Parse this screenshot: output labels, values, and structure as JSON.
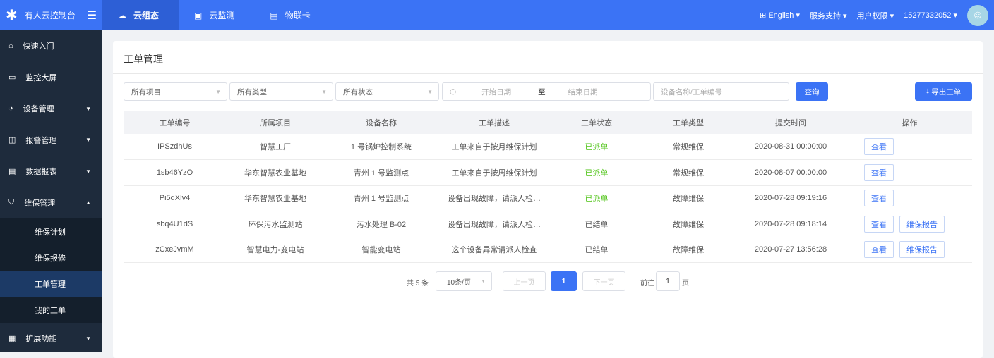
{
  "header": {
    "app_title": "有人云控制台",
    "nav": [
      {
        "label": "云组态",
        "icon": "cloud-icon"
      },
      {
        "label": "云监测",
        "icon": "monitor-icon"
      },
      {
        "label": "物联卡",
        "icon": "sim-card-icon"
      }
    ],
    "language": "English",
    "support": "服务支持",
    "permissions": "用户权限",
    "user": "15277332052"
  },
  "sidebar": {
    "items": [
      {
        "label": "快速入门"
      },
      {
        "label": "监控大屏"
      },
      {
        "label": "设备管理"
      },
      {
        "label": "报警管理"
      },
      {
        "label": "数据报表"
      },
      {
        "label": "维保管理"
      }
    ],
    "sub": [
      {
        "label": "维保计划"
      },
      {
        "label": "维保报修"
      },
      {
        "label": "工单管理"
      },
      {
        "label": "我的工单"
      }
    ],
    "extra": {
      "label": "扩展功能"
    }
  },
  "page": {
    "title": "工单管理"
  },
  "filters": {
    "project": "所有项目",
    "type": "所有类型",
    "status": "所有状态",
    "start": "开始日期",
    "to": "至",
    "end": "结束日期",
    "search_placeholder": "设备名称/工单编号",
    "query": "查询",
    "export": "导出工单"
  },
  "table": {
    "headers": [
      "工单编号",
      "所属项目",
      "设备名称",
      "工单描述",
      "工单状态",
      "工单类型",
      "提交时间",
      "操作"
    ],
    "rows": [
      [
        "IPSzdhUs",
        "智慧工厂",
        "1 号锅炉控制系统",
        "工单来自于按月维保计划",
        "已派单",
        "常规维保",
        "2020-08-31 00:00:00"
      ],
      [
        "1sb46YzO",
        "华东智慧农业基地",
        "青州 1 号监测点",
        "工单来自于按周维保计划",
        "已派单",
        "常规维保",
        "2020-08-07 00:00:00"
      ],
      [
        "Pi5dXlv4",
        "华东智慧农业基地",
        "青州 1 号监测点",
        "设备出现故障，请派人检…",
        "已派单",
        "故障维保",
        "2020-07-28 09:19:16"
      ],
      [
        "sbq4U1dS",
        "环保污水监测站",
        "污水处理 B-02",
        "设备出现故障，请派人检…",
        "已结单",
        "故障维保",
        "2020-07-28 09:18:14"
      ],
      [
        "zCxeJvmM",
        "智慧电力-变电站",
        "智能变电站",
        "这个设备异常请派人检查",
        "已结单",
        "故障维保",
        "2020-07-27 13:56:28"
      ]
    ],
    "view": "查看",
    "report": "维保报告"
  },
  "pagination": {
    "total": "共 5 条",
    "size": "10条/页",
    "prev": "上一页",
    "current": "1",
    "next": "下一页",
    "goto": "前往",
    "goto_value": "1",
    "page_unit": "页"
  }
}
